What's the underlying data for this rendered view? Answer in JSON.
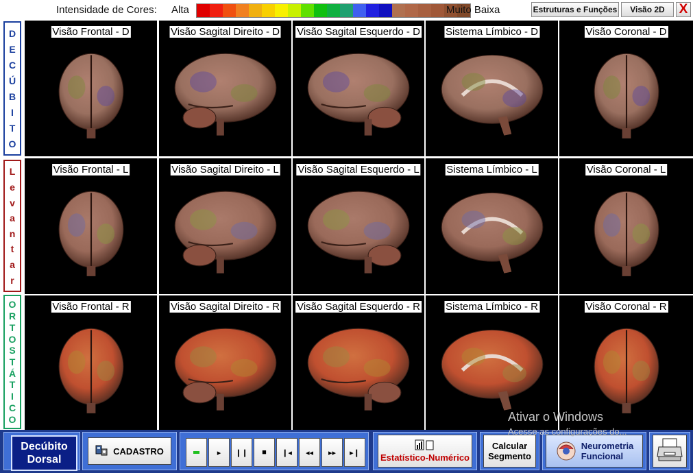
{
  "topbar": {
    "intensity_label": "Intensidade de Cores:",
    "alta_label": "Alta",
    "baixa_label": "Muito Baixa",
    "scale_colors": [
      "#e00000",
      "#f02010",
      "#f05010",
      "#f08020",
      "#f0b010",
      "#f8d000",
      "#f8f000",
      "#c8f000",
      "#60e000",
      "#10c010",
      "#10b040",
      "#20a070",
      "#4060f0",
      "#2020e0",
      "#1010c0",
      "#b07050",
      "#b06848",
      "#a86040",
      "#a05838",
      "#905030",
      "#804828"
    ],
    "btn_estruturas": "Estruturas e Funções",
    "btn_visao2d": "Visão 2D",
    "btn_close": "X"
  },
  "side_labels": {
    "decubito": [
      "D",
      "E",
      "C",
      "Ú",
      "B",
      "I",
      "T",
      "O"
    ],
    "levantar": [
      "L",
      "e",
      "v",
      "a",
      "n",
      "t",
      "a",
      "r"
    ],
    "ortostatico": [
      "O",
      "R",
      "T",
      "O",
      "S",
      "T",
      "Á",
      "T",
      "I",
      "C",
      "O"
    ]
  },
  "rows": [
    {
      "titles": [
        "Visão Frontal - D",
        "Visão Sagital Direito - D",
        "Visão Sagital Esquerdo - D",
        "Sistema Límbico - D",
        "Visão Coronal - D"
      ]
    },
    {
      "titles": [
        "Visão Frontal - L",
        "Visão Sagital Direito - L",
        "Visão Sagital Esquerdo - L",
        "Sistema Límbico - L",
        "Visão Coronal - L"
      ]
    },
    {
      "titles": [
        "Visão Frontal - R",
        "Visão Sagital Direito - R",
        "Visão Sagital Esquerdo - R",
        "Sistema Límbico - R",
        "Visão Coronal - R"
      ]
    }
  ],
  "bottombar": {
    "decubito_line1": "Decúbito",
    "decubito_line2": "Dorsal",
    "cadastro": "CADASTRO",
    "estatistico": "Estatístico-Numérico",
    "calcular_line1": "Calcular",
    "calcular_line2": "Segmento",
    "neurometria_line1": "Neurometria",
    "neurometria_line2": "Funcional"
  },
  "watermark": {
    "line1": "Ativar o Windows",
    "line2": "Acesse as configurações do..."
  }
}
